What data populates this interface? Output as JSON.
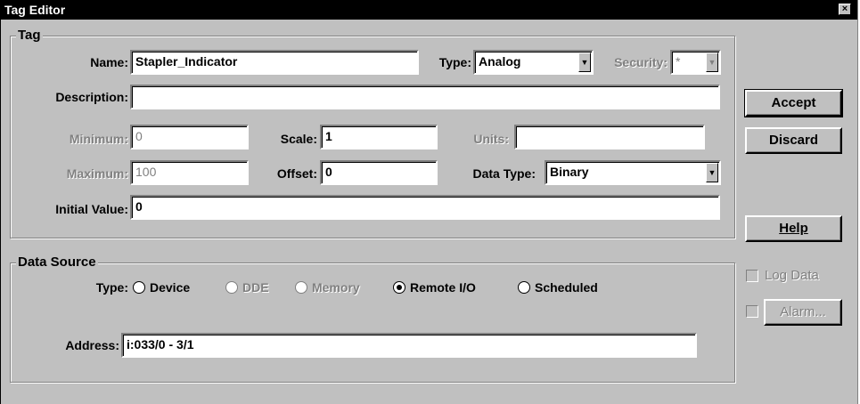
{
  "window": {
    "title": "Tag Editor",
    "close_glyph": "×"
  },
  "tag_group": {
    "legend": "Tag",
    "name_label": "Name:",
    "name_value": "Stapler_Indicator",
    "type_label": "Type:",
    "type_value": "Analog",
    "security_label": "Security:",
    "security_value": "*",
    "description_label": "Description:",
    "description_value": "",
    "minimum_label": "Minimum:",
    "minimum_value": "0",
    "scale_label": "Scale:",
    "scale_value": "1",
    "units_label": "Units:",
    "units_value": "",
    "maximum_label": "Maximum:",
    "maximum_value": "100",
    "offset_label": "Offset:",
    "offset_value": "0",
    "datatype_label": "Data Type:",
    "datatype_value": "Binary",
    "initial_label": "Initial Value:",
    "initial_value": "0"
  },
  "data_source": {
    "legend": "Data Source",
    "type_label": "Type:",
    "options": [
      {
        "label": "Device",
        "checked": false,
        "enabled": true
      },
      {
        "label": "DDE",
        "checked": false,
        "enabled": false
      },
      {
        "label": "Memory",
        "checked": false,
        "enabled": false
      },
      {
        "label": "Remote I/O",
        "checked": true,
        "enabled": true
      },
      {
        "label": "Scheduled",
        "checked": false,
        "enabled": true
      }
    ],
    "address_label": "Address:",
    "address_value": "i:033/0 - 3/1"
  },
  "buttons": {
    "accept": "Accept",
    "discard": "Discard",
    "help": "Help",
    "alarm": "Alarm..."
  },
  "checkboxes": {
    "log_data": "Log Data"
  },
  "icons": {
    "combo_arrow": "chevron-down-icon",
    "close": "close-icon"
  },
  "colors": {
    "face": "#c0c0c0",
    "title_bar": "#000000",
    "disabled_text": "#808080"
  }
}
